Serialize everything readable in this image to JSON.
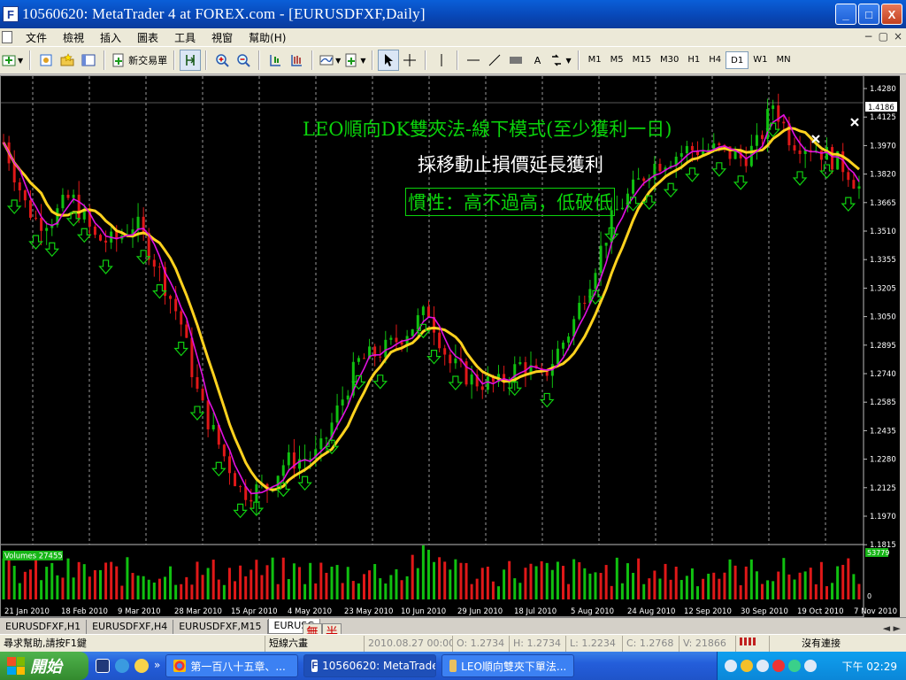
{
  "window": {
    "app_icon": "F",
    "title": "10560620: MetaTrader 4 at FOREX.com - [EURUSDFXF,Daily]",
    "min": "_",
    "max": "□",
    "close": "X"
  },
  "menu": [
    "文件",
    "檢視",
    "插入",
    "圖表",
    "工具",
    "視窗",
    "幫助(H)"
  ],
  "mdi_buttons": [
    "−",
    "▢",
    "×"
  ],
  "toolbar": {
    "new_order": "新交易單",
    "periods": [
      "M1",
      "M5",
      "M15",
      "M30",
      "H1",
      "H4",
      "D1",
      "W1",
      "MN"
    ],
    "active_period": "D1",
    "text_tool": "A"
  },
  "chart": {
    "overlay": {
      "title": "LEO順向DK雙夾法-線下模式(至少獲利一日)",
      "subtitle": "採移動止損價延長獲利",
      "boxed": "慣性：高不過高，低破低"
    },
    "current_price": "1.4186",
    "volume_label": "Volumes 27455",
    "volume_max": "53779",
    "volume_min": "0",
    "price_ticks": [
      "1.4280",
      "1.4125",
      "1.3970",
      "1.3820",
      "1.3665",
      "1.3510",
      "1.3355",
      "1.3205",
      "1.3050",
      "1.2895",
      "1.2740",
      "1.2585",
      "1.2435",
      "1.2280",
      "1.2125",
      "1.1970",
      "1.1815"
    ],
    "date_ticks": [
      "21 Jan 2010",
      "18 Feb 2010",
      "9 Mar 2010",
      "28 Mar 2010",
      "15 Apr 2010",
      "4 May 2010",
      "23 May 2010",
      "10 Jun 2010",
      "29 Jun 2010",
      "18 Jul 2010",
      "5 Aug 2010",
      "24 Aug 2010",
      "12 Sep 2010",
      "30 Sep 2010",
      "19 Oct 2010",
      "7 Nov 2010"
    ],
    "colors": {
      "bull": "#10c010",
      "bear": "#e01818",
      "ma_fast": "#e010e0",
      "ma_slow": "#ffd21e",
      "arrow": "#10d010",
      "grid": "#ffffff",
      "axis_text": "#ffffff"
    }
  },
  "tabs": {
    "items": [
      "EURUSDFXF,H1",
      "EURUSDFXF,H4",
      "EURUSDFXF,M15",
      "EURUSC"
    ],
    "active_index": 3,
    "scroll": "◄ ►"
  },
  "ime": [
    "無",
    "半"
  ],
  "status": {
    "help": "尋求幫助,請按F1鍵",
    "template": "短線六畫",
    "time": "2010.08.27 00:00",
    "open": "O: 1.2734",
    "high": "H: 1.2734",
    "low": "L: 1.2234",
    "close": "C: 1.2768",
    "volume": "V: 21866",
    "connection": "沒有連接"
  },
  "taskbar": {
    "start": "開始",
    "tasks": [
      "第一百八十五章、...",
      "10560620: MetaTrade...",
      "LEO順向雙夾下單法..."
    ],
    "active_task": 1,
    "clock": "下午 02:29",
    "more": "»"
  }
}
